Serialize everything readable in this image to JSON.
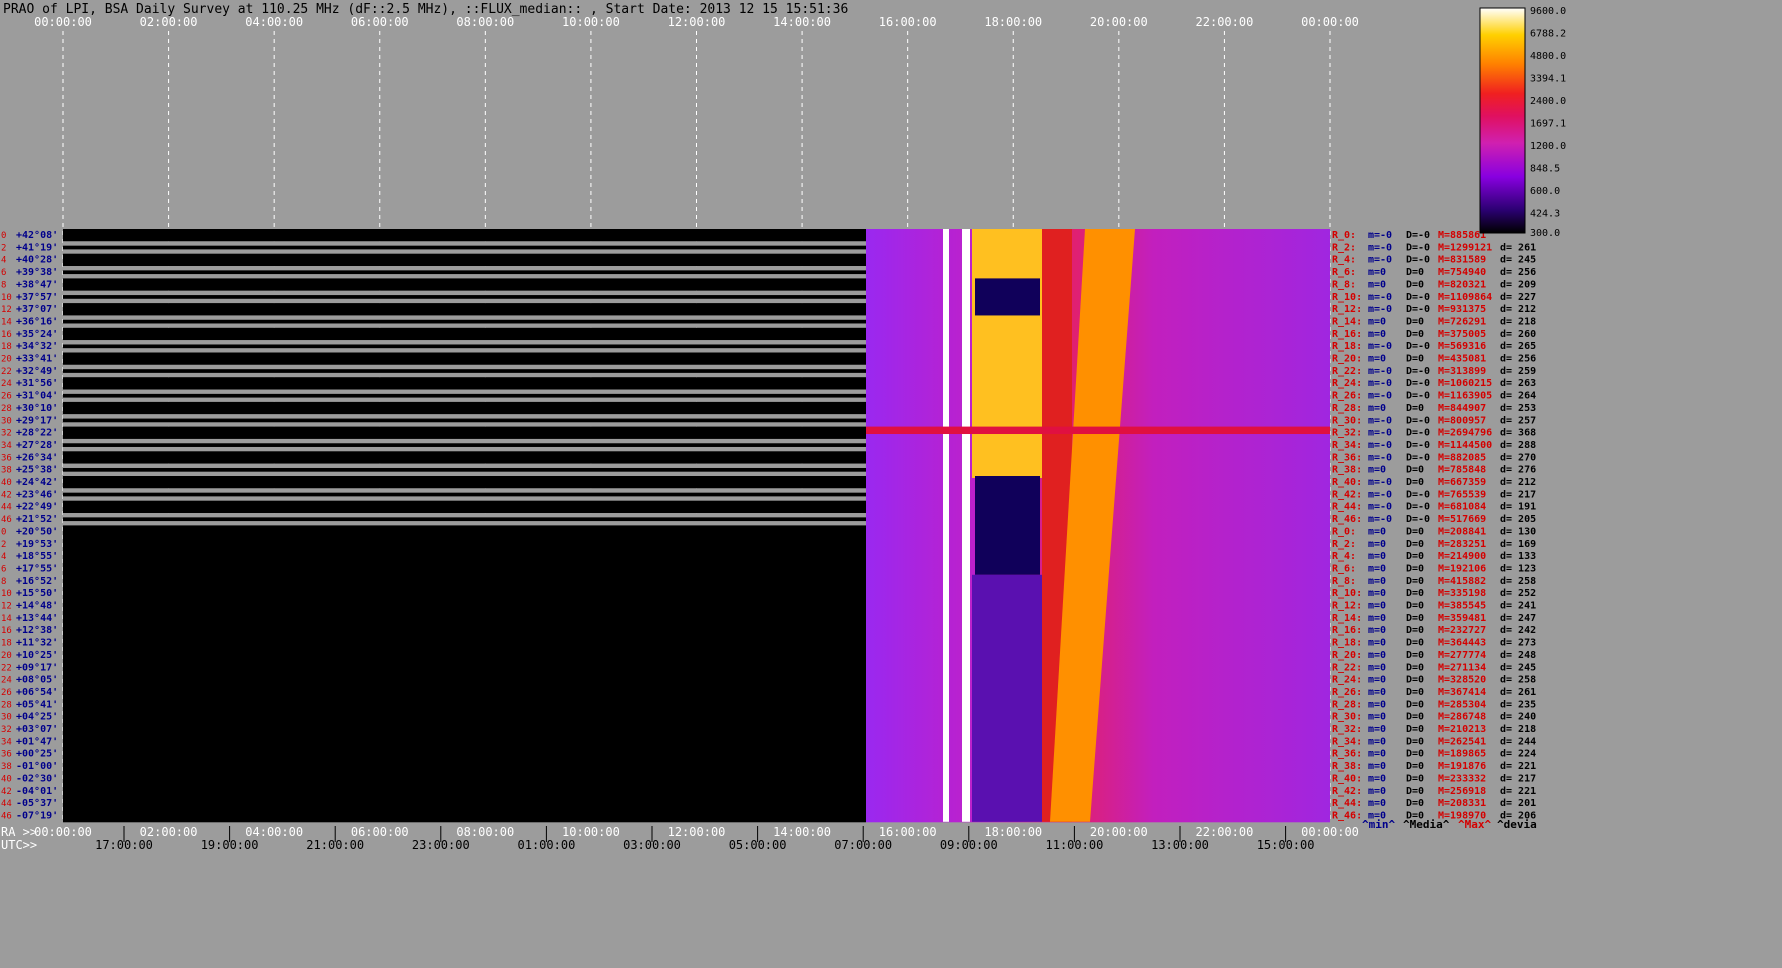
{
  "title": "PRAO of LPI, BSA Daily Survey at 110.25 MHz (dF::2.5 MHz), ::FLUX_median:: , Start Date: 2013 12 15 15:51:36",
  "top_axis": [
    "00:00:00",
    "02:00:00",
    "04:00:00",
    "06:00:00",
    "08:00:00",
    "10:00:00",
    "12:00:00",
    "14:00:00",
    "16:00:00",
    "18:00:00",
    "20:00:00",
    "22:00:00",
    "00:00:00"
  ],
  "bottom_axis": {
    "ra_prefix": "RA >>",
    "utc_prefix": "UTC>>",
    "ra_labels": [
      "00:00:00",
      "02:00:00",
      "04:00:00",
      "06:00:00",
      "08:00:00",
      "10:00:00",
      "12:00:00",
      "14:00:00",
      "16:00:00",
      "18:00:00",
      "20:00:00",
      "22:00:00",
      "00:00:00"
    ],
    "utc_labels": [
      "17:00:00",
      "19:00:00",
      "21:00:00",
      "23:00:00",
      "01:00:00",
      "03:00:00",
      "05:00:00",
      "07:00:00",
      "09:00:00",
      "11:00:00",
      "13:00:00",
      "15:00:00"
    ]
  },
  "colorbar": {
    "labels": [
      "9600.0",
      "6788.2",
      "4800.0",
      "3394.1",
      "2400.0",
      "1697.1",
      "1200.0",
      "848.5",
      "600.0",
      "424.3",
      "300.0"
    ],
    "range": [
      300,
      9600
    ],
    "scale": "log"
  },
  "legend_footer": {
    "min": "^min^",
    "median": "^Media^",
    "max": "^Max^",
    "dev": "^devia"
  },
  "colors": {
    "background": "#9c9c9c",
    "beam_num": "#d40000",
    "dec_label": "#00008b",
    "stat_name": "#d40000",
    "m_val": "#00008b",
    "max_val": "#d40000",
    "dev_val": "#000000"
  },
  "chart_data": {
    "type": "heatmap",
    "x_axis": "RA (hours)",
    "x_range": [
      0,
      24
    ],
    "rows": [
      {
        "beam": "0",
        "dec": "+42°08'",
        "m": "m=-0",
        "d": "D=-0",
        "max": "M=885861",
        "dev": ""
      },
      {
        "beam": "2",
        "dec": "+41°19'",
        "m": "m=-0",
        "d": "D=-0",
        "max": "M=1299121",
        "dev": "d= 261"
      },
      {
        "beam": "4",
        "dec": "+40°28'",
        "m": "m=-0",
        "d": "D=-0",
        "max": "M=831589",
        "dev": "d= 245"
      },
      {
        "beam": "6",
        "dec": "+39°38'",
        "m": "m=0",
        "d": "D=0",
        "max": "M=754940",
        "dev": "d= 256"
      },
      {
        "beam": "8",
        "dec": "+38°47'",
        "m": "m=0",
        "d": "D=0",
        "max": "M=820321",
        "dev": "d= 209"
      },
      {
        "beam": "10",
        "dec": "+37°57'",
        "m": "m=-0",
        "d": "D=-0",
        "max": "M=1109864",
        "dev": "d= 227"
      },
      {
        "beam": "12",
        "dec": "+37°07'",
        "m": "m=-0",
        "d": "D=-0",
        "max": "M=931375",
        "dev": "d= 212"
      },
      {
        "beam": "14",
        "dec": "+36°16'",
        "m": "m=0",
        "d": "D=0",
        "max": "M=726291",
        "dev": "d= 218"
      },
      {
        "beam": "16",
        "dec": "+35°24'",
        "m": "m=0",
        "d": "D=0",
        "max": "M=375005",
        "dev": "d= 260"
      },
      {
        "beam": "18",
        "dec": "+34°32'",
        "m": "m=-0",
        "d": "D=-0",
        "max": "M=569316",
        "dev": "d= 265"
      },
      {
        "beam": "20",
        "dec": "+33°41'",
        "m": "m=0",
        "d": "D=0",
        "max": "M=435081",
        "dev": "d= 256"
      },
      {
        "beam": "22",
        "dec": "+32°49'",
        "m": "m=-0",
        "d": "D=-0",
        "max": "M=313899",
        "dev": "d= 259"
      },
      {
        "beam": "24",
        "dec": "+31°56'",
        "m": "m=-0",
        "d": "D=-0",
        "max": "M=1060215",
        "dev": "d= 263"
      },
      {
        "beam": "26",
        "dec": "+31°04'",
        "m": "m=-0",
        "d": "D=-0",
        "max": "M=1163905",
        "dev": "d= 264"
      },
      {
        "beam": "28",
        "dec": "+30°10'",
        "m": "m=0",
        "d": "D=0",
        "max": "M=844907",
        "dev": "d= 253"
      },
      {
        "beam": "30",
        "dec": "+29°17'",
        "m": "m=-0",
        "d": "D=-0",
        "max": "M=800957",
        "dev": "d= 257"
      },
      {
        "beam": "32",
        "dec": "+28°22'",
        "m": "m=-0",
        "d": "D=-0",
        "max": "M=2694796",
        "dev": "d= 368"
      },
      {
        "beam": "34",
        "dec": "+27°28'",
        "m": "m=-0",
        "d": "D=-0",
        "max": "M=1144500",
        "dev": "d= 288"
      },
      {
        "beam": "36",
        "dec": "+26°34'",
        "m": "m=-0",
        "d": "D=-0",
        "max": "M=882085",
        "dev": "d= 270"
      },
      {
        "beam": "38",
        "dec": "+25°38'",
        "m": "m=0",
        "d": "D=0",
        "max": "M=785848",
        "dev": "d= 276"
      },
      {
        "beam": "40",
        "dec": "+24°42'",
        "m": "m=-0",
        "d": "D=0",
        "max": "M=667359",
        "dev": "d= 212"
      },
      {
        "beam": "42",
        "dec": "+23°46'",
        "m": "m=-0",
        "d": "D=-0",
        "max": "M=765539",
        "dev": "d= 217"
      },
      {
        "beam": "44",
        "dec": "+22°49'",
        "m": "m=-0",
        "d": "D=-0",
        "max": "M=681084",
        "dev": "d= 191"
      },
      {
        "beam": "46",
        "dec": "+21°52'",
        "m": "m=-0",
        "d": "D=-0",
        "max": "M=517669",
        "dev": "d= 205"
      },
      {
        "beam": "0",
        "dec": "+20°50'",
        "m": "m=0",
        "d": "D=0",
        "max": "M=208841",
        "dev": "d= 130"
      },
      {
        "beam": "2",
        "dec": "+19°53'",
        "m": "m=0",
        "d": "D=0",
        "max": "M=283251",
        "dev": "d= 169"
      },
      {
        "beam": "4",
        "dec": "+18°55'",
        "m": "m=0",
        "d": "D=0",
        "max": "M=214900",
        "dev": "d= 133"
      },
      {
        "beam": "6",
        "dec": "+17°55'",
        "m": "m=0",
        "d": "D=0",
        "max": "M=192106",
        "dev": "d= 123"
      },
      {
        "beam": "8",
        "dec": "+16°52'",
        "m": "m=0",
        "d": "D=0",
        "max": "M=415882",
        "dev": "d= 258"
      },
      {
        "beam": "10",
        "dec": "+15°50'",
        "m": "m=0",
        "d": "D=0",
        "max": "M=335198",
        "dev": "d= 252"
      },
      {
        "beam": "12",
        "dec": "+14°48'",
        "m": "m=0",
        "d": "D=0",
        "max": "M=385545",
        "dev": "d= 241"
      },
      {
        "beam": "14",
        "dec": "+13°44'",
        "m": "m=0",
        "d": "D=0",
        "max": "M=359481",
        "dev": "d= 247"
      },
      {
        "beam": "16",
        "dec": "+12°38'",
        "m": "m=0",
        "d": "D=0",
        "max": "M=232727",
        "dev": "d= 242"
      },
      {
        "beam": "18",
        "dec": "+11°32'",
        "m": "m=0",
        "d": "D=0",
        "max": "M=364443",
        "dev": "d= 273"
      },
      {
        "beam": "20",
        "dec": "+10°25'",
        "m": "m=0",
        "d": "D=0",
        "max": "M=277774",
        "dev": "d= 248"
      },
      {
        "beam": "22",
        "dec": "+09°17'",
        "m": "m=0",
        "d": "D=0",
        "max": "M=271134",
        "dev": "d= 245"
      },
      {
        "beam": "24",
        "dec": "+08°05'",
        "m": "m=0",
        "d": "D=0",
        "max": "M=328520",
        "dev": "d= 258"
      },
      {
        "beam": "26",
        "dec": "+06°54'",
        "m": "m=0",
        "d": "D=0",
        "max": "M=367414",
        "dev": "d= 261"
      },
      {
        "beam": "28",
        "dec": "+05°41'",
        "m": "m=0",
        "d": "D=0",
        "max": "M=285304",
        "dev": "d= 235"
      },
      {
        "beam": "30",
        "dec": "+04°25'",
        "m": "m=0",
        "d": "D=0",
        "max": "M=286748",
        "dev": "d= 240"
      },
      {
        "beam": "32",
        "dec": "+03°07'",
        "m": "m=0",
        "d": "D=0",
        "max": "M=210213",
        "dev": "d= 218"
      },
      {
        "beam": "34",
        "dec": "+01°47'",
        "m": "m=0",
        "d": "D=0",
        "max": "M=262541",
        "dev": "d= 244"
      },
      {
        "beam": "36",
        "dec": "+00°25'",
        "m": "m=0",
        "d": "D=0",
        "max": "M=189865",
        "dev": "d= 224"
      },
      {
        "beam": "38",
        "dec": "-01°00'",
        "m": "m=0",
        "d": "D=0",
        "max": "M=191876",
        "dev": "d= 221"
      },
      {
        "beam": "40",
        "dec": "-02°30'",
        "m": "m=0",
        "d": "D=0",
        "max": "M=233332",
        "dev": "d= 217"
      },
      {
        "beam": "42",
        "dec": "-04°01'",
        "m": "m=0",
        "d": "D=0",
        "max": "M=256918",
        "dev": "d= 221"
      },
      {
        "beam": "44",
        "dec": "-05°37'",
        "m": "m=0",
        "d": "D=0",
        "max": "M=208331",
        "dev": "d= 201"
      },
      {
        "beam": "46",
        "dec": "-07°19'",
        "m": "m=0",
        "d": "D=0",
        "max": "M=198970",
        "dev": "d= 206"
      }
    ]
  }
}
